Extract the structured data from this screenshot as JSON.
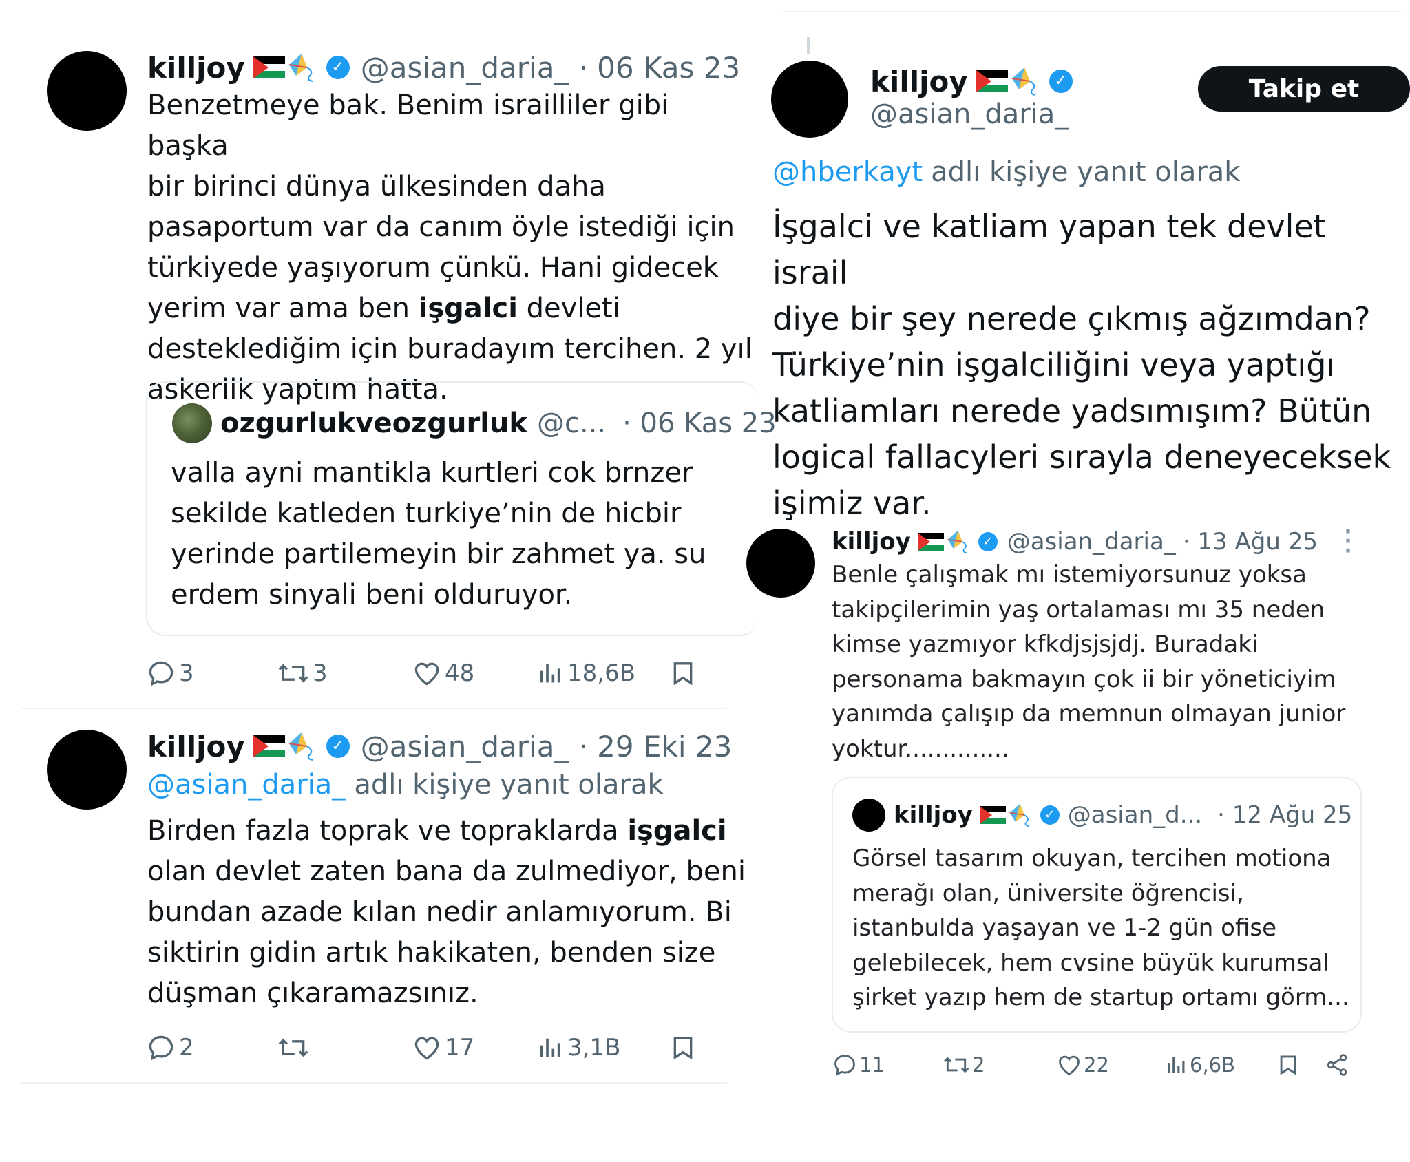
{
  "tweet1": {
    "name": "killjoy",
    "handle": "@asian_daria_",
    "date": "· 06 Kas 23",
    "text_a": "Benzetmeye bak. Benim israilliler gibi başka\nbir birinci dünya ülkesinden daha\npasaportum var da canım öyle istediği için\ntürkiyede yaşıyorum çünkü. Hani gidecek\nyerim var ama ben ",
    "text_bold": "işgalci",
    "text_b": " devleti\ndesteklediğim için buradayım tercihen. 2 yıl\naskerlik yaptım hatta.",
    "quote": {
      "name": "ozgurlukveozgurluk",
      "handle": "@c...",
      "date": "· 06 Kas 23",
      "text": "valla ayni mantikla kurtleri cok brnzer\nsekilde katleden turkiye’nin de hicbir\nyerinde partilemeyin bir zahmet ya. su\nerdem sinyali beni olduruyor."
    },
    "replies": "3",
    "retweets": "3",
    "likes": "48",
    "views": "18,6B"
  },
  "tweet2": {
    "name": "killjoy",
    "handle": "@asian_daria_",
    "date": "· 29 Eki 23",
    "reply_to_handle": "@asian_daria_",
    "reply_to_suffix": "adlı kişiye yanıt olarak",
    "text_a": "Birden fazla toprak ve topraklarda ",
    "text_bold": "işgalci",
    "text_b": "\nolan devlet zaten bana da zulmediyor, beni\nbundan azade kılan nedir anlamıyorum. Bi\nsiktirin gidin artık hakikaten, benden size\ndüşman çıkaramazsınız.",
    "replies": "2",
    "likes": "17",
    "views": "3,1B"
  },
  "tweet3": {
    "name": "killjoy",
    "handle": "@asian_daria_",
    "follow_label": "Takip et",
    "reply_to_handle": "@hberkayt",
    "reply_to_suffix": "adlı kişiye yanıt olarak",
    "text": "İşgalci ve katliam yapan tek devlet israil\ndiye bir şey nerede çıkmış ağzımdan?\nTürkiye’nin işgalciliğini veya yaptığı\nkatliamları nerede yadsımışım? Bütün\nlogical fallacyleri sırayla deneyeceksek\nişimiz var."
  },
  "tweet4": {
    "name": "killjoy",
    "handle": "@asian_daria_",
    "date": "· 13 Ağu 25",
    "text": "Benle çalışmak mı istemiyorsunuz yoksa\ntakipçilerimin yaş ortalaması mı 35 neden\nkimse yazmıyor kfkdjsjsjdj. Buradaki\npersonama bakmayın çok ii bir yöneticiyim\nyanımda çalışıp da memnun olmayan junior\nyoktur..............",
    "quote": {
      "name": "killjoy",
      "handle": "@asian_d...",
      "date": "· 12 Ağu 25",
      "text": "Görsel tasarım okuyan, tercihen motiona\nmerağı olan, üniversite öğrencisi,\nistanbulda yaşayan ve 1-2 gün ofise\ngelebilecek, hem cvsine büyük kurumsal\nşirket yazıp hem de startup ortamı görm..."
    },
    "replies": "11",
    "retweets": "2",
    "likes": "22",
    "views": "6,6B"
  },
  "colors": {
    "link": "#1d9bf0",
    "muted": "#536471",
    "text": "#0f1419",
    "border": "#e6ecf0"
  },
  "icons": [
    "verified-badge-icon",
    "palestine-flag-icon",
    "kite-icon",
    "reply-icon",
    "retweet-icon",
    "like-icon",
    "views-icon",
    "bookmark-icon",
    "share-icon",
    "more-icon"
  ]
}
